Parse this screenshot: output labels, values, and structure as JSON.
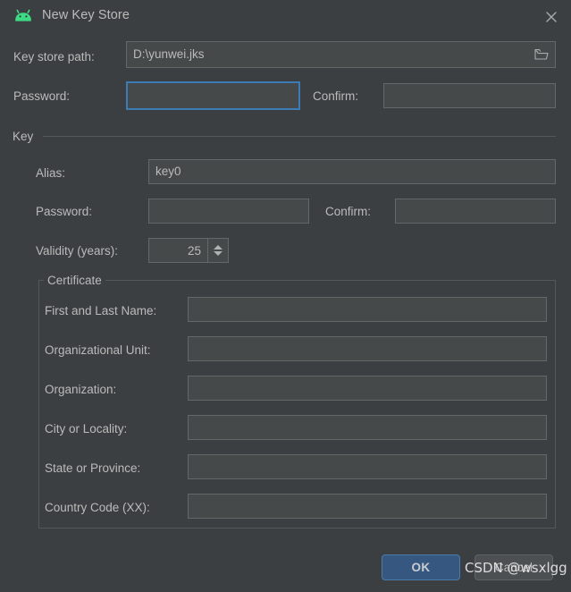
{
  "window": {
    "title": "New Key Store",
    "app_icon": "android-robot-icon",
    "close_icon": "close-icon",
    "background_color": "#3c3f41",
    "accent_color": "#365880",
    "focus_border_color": "#3d7bb5",
    "android_green": "#3ddc84"
  },
  "keystore": {
    "path_label": "Key store path:",
    "path_value": "D:\\yunwei.jks",
    "browse_icon": "folder-open-icon",
    "password_label": "Password:",
    "password_value": "",
    "password_focused": true,
    "confirm_label": "Confirm:",
    "confirm_value": ""
  },
  "key": {
    "group_label": "Key",
    "alias_label": "Alias:",
    "alias_value": "key0",
    "password_label": "Password:",
    "password_value": "",
    "confirm_label": "Confirm:",
    "confirm_value": "",
    "validity_label": "Validity (years):",
    "validity_value": "25",
    "spinner_up_icon": "chevron-up-icon",
    "spinner_down_icon": "chevron-down-icon"
  },
  "certificate": {
    "group_label": "Certificate",
    "fields": [
      {
        "label": "First and Last Name:",
        "value": ""
      },
      {
        "label": "Organizational Unit:",
        "value": ""
      },
      {
        "label": "Organization:",
        "value": ""
      },
      {
        "label": "City or Locality:",
        "value": ""
      },
      {
        "label": "State or Province:",
        "value": ""
      },
      {
        "label": "Country Code (XX):",
        "value": ""
      }
    ]
  },
  "buttons": {
    "ok_label": "OK",
    "cancel_label": "Cancel"
  },
  "watermark": {
    "text": "CSDN @wsxlgg"
  }
}
